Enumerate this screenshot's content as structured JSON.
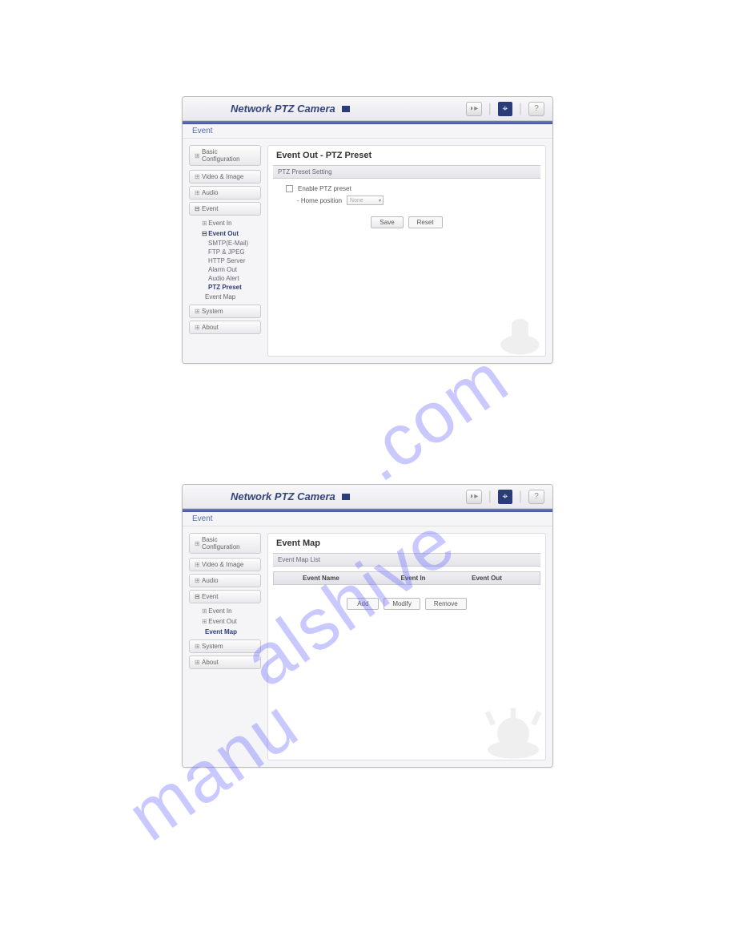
{
  "header": {
    "title": "Network PTZ Camera"
  },
  "crumb": {
    "event": "Event"
  },
  "sidebar": {
    "basic_config": "Basic Configuration",
    "video_image": "Video & Image",
    "audio": "Audio",
    "event": "Event",
    "event_in": "Event In",
    "event_out": "Event Out",
    "smtp": "SMTP(E-Mail)",
    "ftp": "FTP & JPEG",
    "http": "HTTP Server",
    "alarm": "Alarm Out",
    "audio_alert": "Audio Alert",
    "ptz_preset": "PTZ Preset",
    "event_map": "Event Map",
    "system": "System",
    "about": "About"
  },
  "panel1": {
    "title": "Event Out - PTZ Preset",
    "section": "PTZ Preset Setting",
    "enable_label": "Enable PTZ preset",
    "home_label": "- Home position",
    "home_value": "None",
    "save": "Save",
    "reset": "Reset"
  },
  "panel2": {
    "title": "Event Map",
    "section": "Event Map List",
    "col_name": "Event Name",
    "col_in": "Event In",
    "col_out": "Event Out",
    "add": "Add",
    "modify": "Modify",
    "remove": "Remove"
  }
}
